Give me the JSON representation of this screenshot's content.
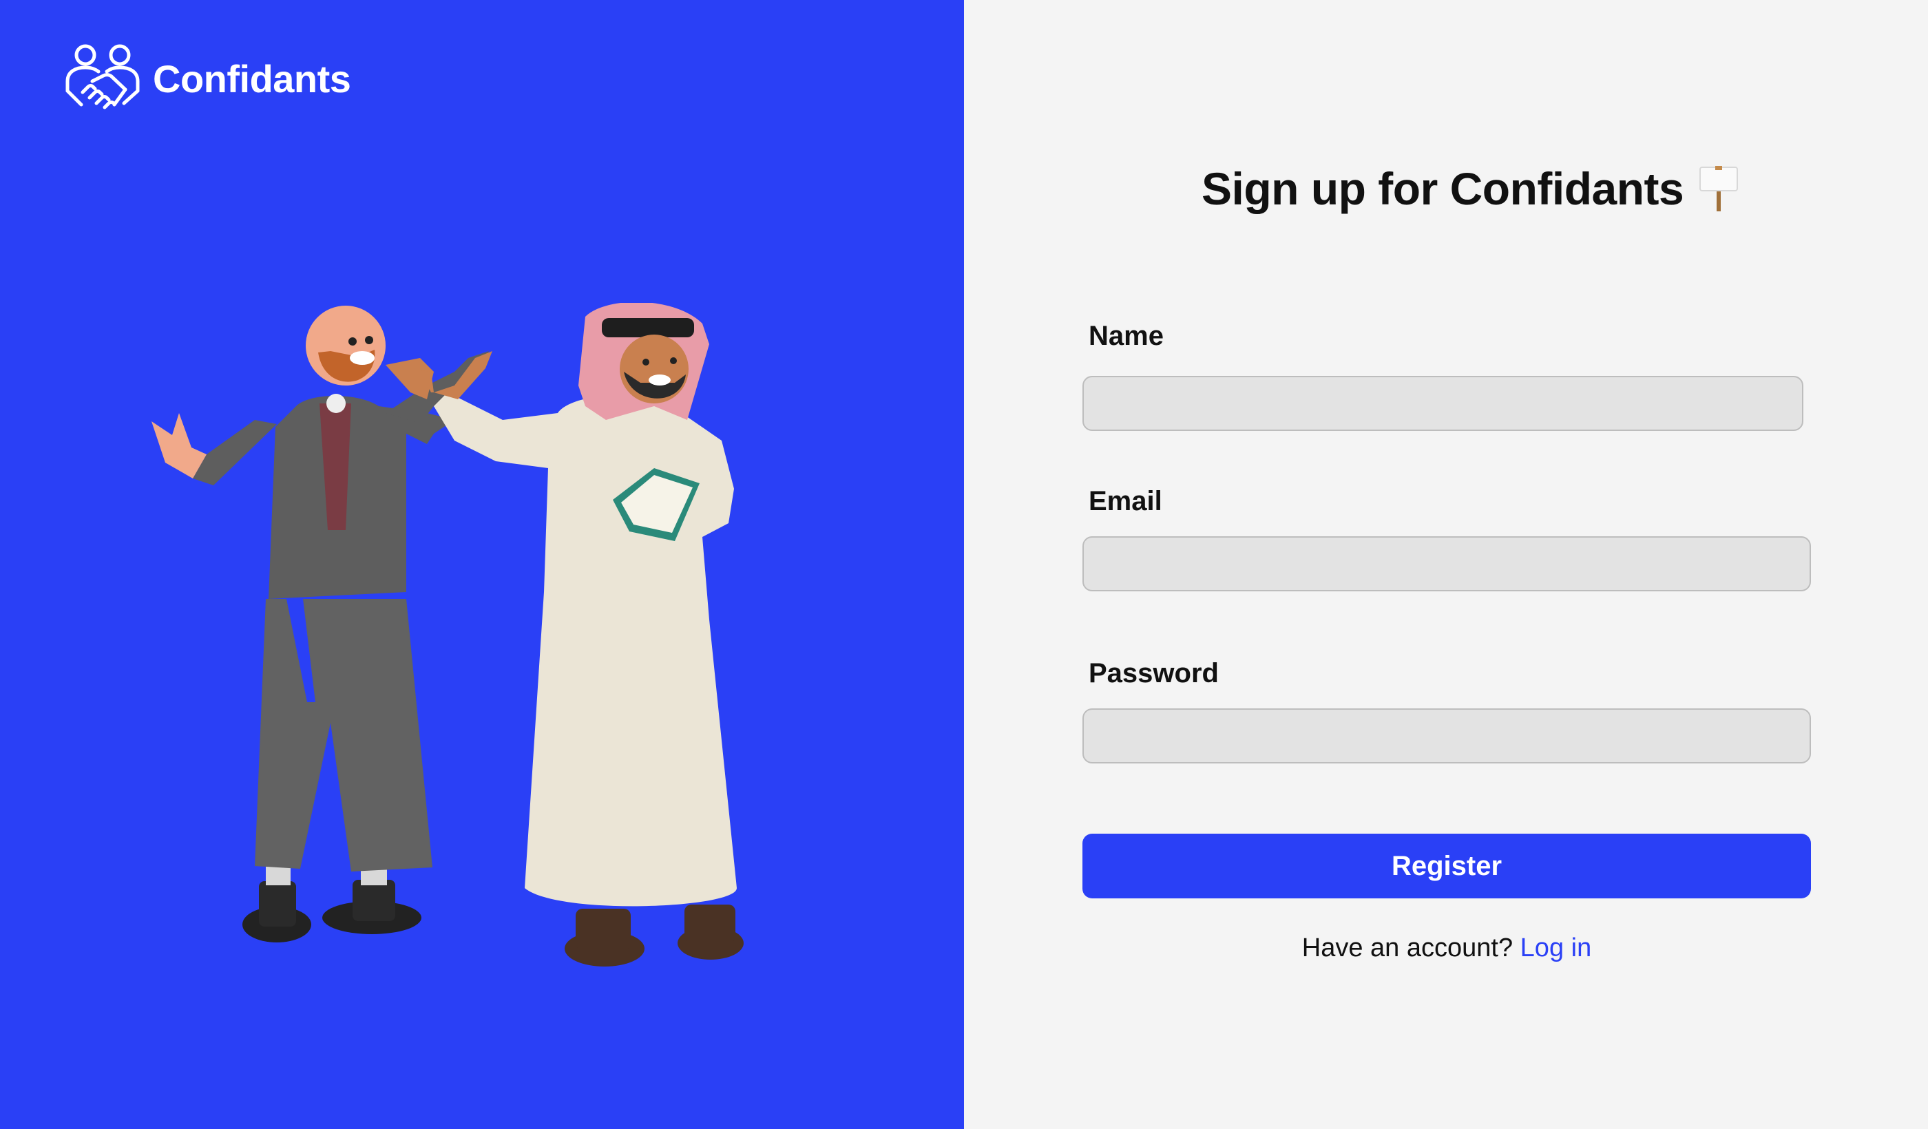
{
  "brand": {
    "name": "Confidants",
    "logo_icon": "handshake-people-icon"
  },
  "illustration": {
    "icon": "two-men-illustration"
  },
  "signup": {
    "title": "Sign up for Confidants",
    "title_icon": "placard-sign-icon",
    "name_label": "Name",
    "name_value": "",
    "email_label": "Email",
    "email_value": "",
    "password_label": "Password",
    "password_value": "",
    "register_label": "Register",
    "have_account_text": "Have an account?",
    "login_link": "Log in"
  },
  "colors": {
    "brand_blue": "#2a40f6",
    "background": "#f4f4f4",
    "field_background": "#e3e3e3"
  }
}
